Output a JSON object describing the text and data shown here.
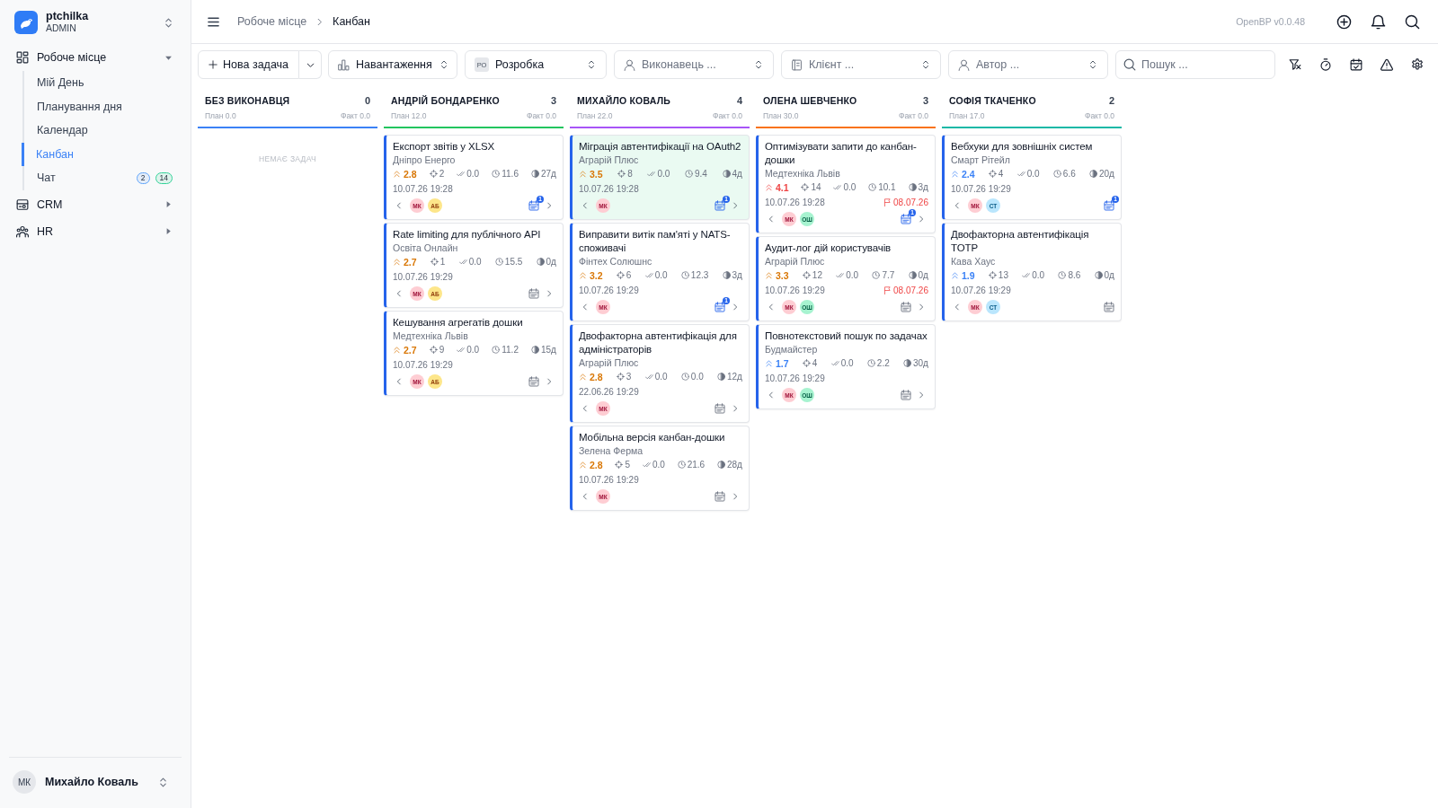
{
  "brand": {
    "name": "ptchilka",
    "role": "ADMIN"
  },
  "nav": [
    {
      "label": "Робоче місце",
      "expanded": true,
      "children": [
        {
          "label": "Мій День",
          "selected": false
        },
        {
          "label": "Планування дня",
          "selected": false
        },
        {
          "label": "Календар",
          "selected": false
        },
        {
          "label": "Канбан",
          "selected": true
        },
        {
          "label": "Чат",
          "selected": false,
          "badges": [
            {
              "text": "2",
              "color": "#60a5fa"
            },
            {
              "text": "14",
              "color": "#34d399"
            }
          ]
        }
      ]
    },
    {
      "label": "CRM",
      "expanded": false
    },
    {
      "label": "HR",
      "expanded": false
    }
  ],
  "user": {
    "initials": "МК",
    "name": "Михайло Коваль"
  },
  "breadcrumbs": [
    "Робоче місце",
    "Канбан"
  ],
  "version": "OpenBP v0.0.48",
  "toolbar": {
    "new_task": "Нова задача",
    "selects": [
      {
        "kind": "workload",
        "value": "Навантаження"
      },
      {
        "kind": "project",
        "badge": "РО",
        "value": "Розробка"
      },
      {
        "kind": "person",
        "placeholder": "Виконавець ..."
      },
      {
        "kind": "client",
        "placeholder": "Клієнт ..."
      },
      {
        "kind": "person",
        "placeholder": "Автор ..."
      }
    ],
    "search": {
      "placeholder": "Пошук ..."
    }
  },
  "columns": [
    {
      "name": "БЕЗ ВИКОНАВЦЯ",
      "count": "0",
      "plan": "План 0.0",
      "fact": "Факт 0.0",
      "color": "#3b82f6",
      "empty_text": "НЕМАЄ ЗАДАЧ"
    },
    {
      "name": "АНДРІЙ БОНДАРЕНКО",
      "count": "3",
      "plan": "План 12.0",
      "fact": "Факт 0.0",
      "color": "#22c55e",
      "cards": [
        {
          "title": "Експорт звітів у XLSX",
          "client": "Дніпро Енерго",
          "highlighted": false,
          "priority": {
            "value": "2.8",
            "color": "#d97706"
          },
          "metrics": [
            {
              "kind": "target",
              "value": "2"
            },
            {
              "kind": "done",
              "value": "0.0"
            },
            {
              "kind": "hours",
              "value": "11.6"
            },
            {
              "kind": "age",
              "value": "27д"
            }
          ],
          "date": "10.07.26 19:28",
          "avatars": [
            {
              "initials": "МК",
              "color": "#fecdd3"
            },
            {
              "initials": "АБ",
              "color": "#fde68a"
            }
          ],
          "calendar_badge": "1",
          "move_right": true
        },
        {
          "title": "Rate limiting для публічного API",
          "client": "Освіта Онлайн",
          "highlighted": false,
          "priority": {
            "value": "2.7",
            "color": "#d97706"
          },
          "metrics": [
            {
              "kind": "target",
              "value": "1"
            },
            {
              "kind": "done",
              "value": "0.0"
            },
            {
              "kind": "hours",
              "value": "15.5"
            },
            {
              "kind": "age",
              "value": "0д"
            }
          ],
          "date": "10.07.26 19:29",
          "avatars": [
            {
              "initials": "МК",
              "color": "#fecdd3"
            },
            {
              "initials": "АБ",
              "color": "#fde68a"
            }
          ],
          "move_right": true
        },
        {
          "title": "Кешування агрегатів дошки",
          "client": "Медтехніка Львів",
          "highlighted": false,
          "priority": {
            "value": "2.7",
            "color": "#d97706"
          },
          "metrics": [
            {
              "kind": "target",
              "value": "9"
            },
            {
              "kind": "done",
              "value": "0.0"
            },
            {
              "kind": "hours",
              "value": "11.2"
            },
            {
              "kind": "age",
              "value": "15д"
            }
          ],
          "date": "10.07.26 19:29",
          "avatars": [
            {
              "initials": "МК",
              "color": "#fecdd3"
            },
            {
              "initials": "АБ",
              "color": "#fde68a"
            }
          ],
          "move_right": true
        }
      ]
    },
    {
      "name": "МИХАЙЛО КОВАЛЬ",
      "count": "4",
      "plan": "План 22.0",
      "fact": "Факт 0.0",
      "color": "#a855f7",
      "cards": [
        {
          "title": "Міграція автентифікації на OAuth2",
          "client": "Аграрій Плюс",
          "highlighted": true,
          "priority": {
            "value": "3.5",
            "color": "#d97706"
          },
          "metrics": [
            {
              "kind": "target",
              "value": "8"
            },
            {
              "kind": "done",
              "value": "0.0"
            },
            {
              "kind": "hours",
              "value": "9.4"
            },
            {
              "kind": "age",
              "value": "4д"
            }
          ],
          "date": "10.07.26 19:28",
          "avatars": [
            {
              "initials": "МК",
              "color": "#fecdd3"
            }
          ],
          "calendar_badge": "1",
          "move_right": true
        },
        {
          "title": "Виправити витік пам'яті у NATS-споживачі",
          "client": "Фінтех Солюшнс",
          "highlighted": false,
          "priority": {
            "value": "3.2",
            "color": "#d97706"
          },
          "metrics": [
            {
              "kind": "target",
              "value": "6"
            },
            {
              "kind": "done",
              "value": "0.0"
            },
            {
              "kind": "hours",
              "value": "12.3"
            },
            {
              "kind": "age",
              "value": "3д"
            }
          ],
          "date": "10.07.26 19:29",
          "avatars": [
            {
              "initials": "МК",
              "color": "#fecdd3"
            }
          ],
          "calendar_badge": "1",
          "move_right": true
        },
        {
          "title": "Двофакторна автентифікація для адміністраторів",
          "client": "Аграрій Плюс",
          "highlighted": false,
          "priority": {
            "value": "2.8",
            "color": "#d97706"
          },
          "metrics": [
            {
              "kind": "target",
              "value": "3"
            },
            {
              "kind": "done",
              "value": "0.0"
            },
            {
              "kind": "hours",
              "value": "0.0"
            },
            {
              "kind": "age",
              "value": "12д"
            }
          ],
          "date": "22.06.26 19:29",
          "avatars": [
            {
              "initials": "МК",
              "color": "#fecdd3"
            }
          ],
          "move_right": true
        },
        {
          "title": "Мобільна версія канбан-дошки",
          "client": "Зелена Ферма",
          "highlighted": false,
          "priority": {
            "value": "2.8",
            "color": "#d97706"
          },
          "metrics": [
            {
              "kind": "target",
              "value": "5"
            },
            {
              "kind": "done",
              "value": "0.0"
            },
            {
              "kind": "hours",
              "value": "21.6"
            },
            {
              "kind": "age",
              "value": "28д"
            }
          ],
          "date": "10.07.26 19:29",
          "avatars": [
            {
              "initials": "МК",
              "color": "#fecdd3"
            }
          ],
          "move_right": true
        }
      ]
    },
    {
      "name": "ОЛЕНА ШЕВЧЕНКО",
      "count": "3",
      "plan": "План 30.0",
      "fact": "Факт 0.0",
      "color": "#f97316",
      "cards": [
        {
          "title": "Оптимізувати запити до канбан-дошки",
          "client": "Медтехніка Львів",
          "highlighted": false,
          "priority": {
            "value": "4.1",
            "color": "#ef4444"
          },
          "metrics": [
            {
              "kind": "target",
              "value": "14"
            },
            {
              "kind": "done",
              "value": "0.0"
            },
            {
              "kind": "hours",
              "value": "10.1"
            },
            {
              "kind": "age",
              "value": "3д"
            }
          ],
          "date": "10.07.26 19:28",
          "due": "08.07.26",
          "avatars": [
            {
              "initials": "МК",
              "color": "#fecdd3"
            },
            {
              "initials": "ОШ",
              "color": "#a7f3d0"
            }
          ],
          "calendar_badge": "1",
          "move_right": true
        },
        {
          "title": "Аудит-лог дій користувачів",
          "client": "Аграрій Плюс",
          "highlighted": false,
          "priority": {
            "value": "3.3",
            "color": "#d97706"
          },
          "metrics": [
            {
              "kind": "target",
              "value": "12"
            },
            {
              "kind": "done",
              "value": "0.0"
            },
            {
              "kind": "hours",
              "value": "7.7"
            },
            {
              "kind": "age",
              "value": "0д"
            }
          ],
          "date": "10.07.26 19:29",
          "due": "08.07.26",
          "avatars": [
            {
              "initials": "МК",
              "color": "#fecdd3"
            },
            {
              "initials": "ОШ",
              "color": "#a7f3d0"
            }
          ],
          "move_right": true
        },
        {
          "title": "Повнотекстовий пошук по задачах",
          "client": "Будмайстер",
          "highlighted": false,
          "priority": {
            "value": "1.7",
            "color": "#3b82f6"
          },
          "metrics": [
            {
              "kind": "target",
              "value": "4"
            },
            {
              "kind": "done",
              "value": "0.0"
            },
            {
              "kind": "hours",
              "value": "2.2"
            },
            {
              "kind": "age",
              "value": "30д"
            }
          ],
          "date": "10.07.26 19:29",
          "avatars": [
            {
              "initials": "МК",
              "color": "#fecdd3"
            },
            {
              "initials": "ОШ",
              "color": "#a7f3d0"
            }
          ],
          "move_right": true
        }
      ]
    },
    {
      "name": "СОФІЯ ТКАЧЕНКО",
      "count": "2",
      "plan": "План 17.0",
      "fact": "Факт 0.0",
      "color": "#14b8a6",
      "cards": [
        {
          "title": "Вебхуки для зовнішніх систем",
          "client": "Смарт Рітейл",
          "highlighted": false,
          "priority": {
            "value": "2.4",
            "color": "#3b82f6"
          },
          "metrics": [
            {
              "kind": "target",
              "value": "4"
            },
            {
              "kind": "done",
              "value": "0.0"
            },
            {
              "kind": "hours",
              "value": "6.6"
            },
            {
              "kind": "age",
              "value": "20д"
            }
          ],
          "date": "10.07.26 19:29",
          "avatars": [
            {
              "initials": "МК",
              "color": "#fecdd3"
            },
            {
              "initials": "СТ",
              "color": "#bae6fd"
            }
          ],
          "calendar_badge": "1",
          "move_right": false
        },
        {
          "title": "Двофакторна автентифікація TOTP",
          "client": "Кава Хаус",
          "highlighted": false,
          "priority": {
            "value": "1.9",
            "color": "#3b82f6"
          },
          "metrics": [
            {
              "kind": "target",
              "value": "13"
            },
            {
              "kind": "done",
              "value": "0.0"
            },
            {
              "kind": "hours",
              "value": "8.6"
            },
            {
              "kind": "age",
              "value": "0д"
            }
          ],
          "date": "10.07.26 19:29",
          "avatars": [
            {
              "initials": "МК",
              "color": "#fecdd3"
            },
            {
              "initials": "СТ",
              "color": "#bae6fd"
            }
          ],
          "move_right": false
        }
      ]
    }
  ]
}
